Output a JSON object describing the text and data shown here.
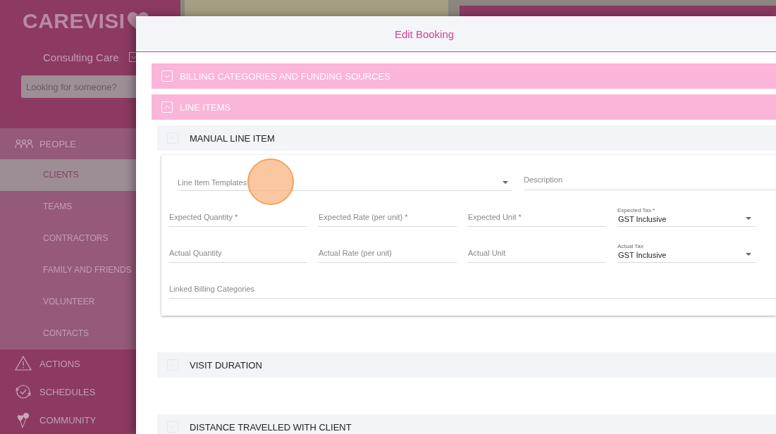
{
  "sidebar": {
    "logo": "CAREVISI",
    "organisation": "Consulting Care",
    "search": {
      "placeholder": "Looking for someone?"
    },
    "items": [
      {
        "label": "PEOPLE",
        "kind": "people",
        "selected": false,
        "children": [
          {
            "label": "CLIENTS",
            "selected": true
          },
          {
            "label": "TEAMS",
            "selected": false
          },
          {
            "label": "CONTRACTORS",
            "selected": false
          },
          {
            "label": "FAMILY AND FRIENDS",
            "selected": false
          },
          {
            "label": "VOLUNTEER",
            "selected": false
          },
          {
            "label": "CONTACTS",
            "selected": false
          }
        ]
      },
      {
        "label": "ACTIONS",
        "kind": "warning",
        "selected": false
      },
      {
        "label": "SCHEDULES",
        "kind": "clock",
        "selected": false
      },
      {
        "label": "COMMUNITY",
        "kind": "balloons",
        "selected": false
      }
    ]
  },
  "dialog": {
    "title": "Edit Booking",
    "sections": [
      {
        "title": "BILLING CATEGORIES AND FUNDING SOURCES",
        "expanded": false
      },
      {
        "title": "LINE ITEMS",
        "expanded": true,
        "subsections": [
          {
            "title": "MANUAL LINE ITEM",
            "expanded": true,
            "rows": [
              [
                {
                  "kind": "select",
                  "placeholder": "Line Item Templates"
                },
                {
                  "kind": "input",
                  "placeholder": "Description"
                }
              ],
              [
                {
                  "kind": "input",
                  "placeholder": "Expected Quantity *"
                },
                {
                  "kind": "input",
                  "placeholder": "Expected Rate (per unit) *"
                },
                {
                  "kind": "input",
                  "placeholder": "Expected Unit *"
                },
                {
                  "kind": "select",
                  "label": "Expected Tax *",
                  "value": "GST Inclusive"
                }
              ],
              [
                {
                  "kind": "input",
                  "placeholder": "Actual Quantity"
                },
                {
                  "kind": "input",
                  "placeholder": "Actual Rate (per unit)"
                },
                {
                  "kind": "input",
                  "placeholder": "Actual Unit"
                },
                {
                  "kind": "select",
                  "label": "Actual Tax",
                  "value": "GST Inclusive"
                }
              ],
              [
                {
                  "kind": "input",
                  "placeholder": "Linked Billing Categories"
                }
              ]
            ]
          },
          {
            "title": "VISIT DURATION",
            "expanded": false
          },
          {
            "title": "DISTANCE TRAVELLED WITH CLIENT",
            "expanded": false
          }
        ]
      }
    ]
  }
}
